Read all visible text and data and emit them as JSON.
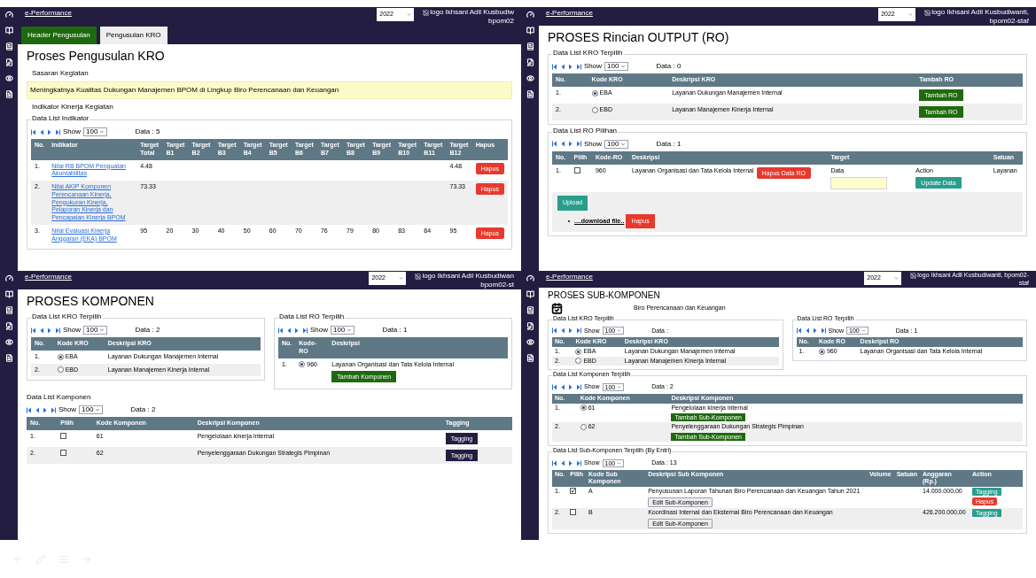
{
  "panels": [
    {
      "header": {
        "link": "e-Performance",
        "year": "2022",
        "user": "logo Ikhsani Adil Kusbudiw",
        "role": "bpom02"
      },
      "tabs": [
        {
          "label": "Header Pengusulan",
          "selected": false
        },
        {
          "label": "Pengusulan KRO",
          "selected": true
        }
      ],
      "title": "Proses Pengusulan KRO",
      "blocks": [
        {
          "kind": "label",
          "text": "Sasaran Kegiatan"
        },
        {
          "kind": "highlight",
          "text": "Meningkatnya Kualitas Dukungan Manajemen BPOM di Lingkup Biro Perencanaan dan Keuangan"
        },
        {
          "kind": "label",
          "text": "Indikator Kinerja Kegiatan"
        },
        {
          "kind": "fieldset",
          "legend": "Data List Indikator",
          "blocks": [
            {
              "kind": "pager",
              "show_label": "Show",
              "show": "100",
              "data": "Data : 5"
            },
            {
              "kind": "table",
              "columns": [
                "No.",
                "Indikator",
                "Target Total",
                "Target B1",
                "Target B2",
                "Target B3",
                "Target B4",
                "Target B5",
                "Target B6",
                "Target B7",
                "Target B8",
                "Target B9",
                "Target B10",
                "Target B11",
                "Target B12",
                "Hapus"
              ],
              "rows": [
                [
                  "1.",
                  [
                    {
                      "kind": "link",
                      "text": "Nilai RB BPOM Penguatan Akuntabilitas"
                    }
                  ],
                  "4.48",
                  null,
                  null,
                  null,
                  null,
                  null,
                  null,
                  null,
                  null,
                  null,
                  null,
                  null,
                  "4.48",
                  [
                    {
                      "kind": "danger",
                      "text": "Hapus"
                    }
                  ]
                ],
                [
                  "2.",
                  [
                    {
                      "kind": "link",
                      "text": "Nilai AKIP Komponen Perencanaan Kinerja, Pengukuran Kinerja, Pelaporan Kinerja dan Pencapaian Kinerja BPOM"
                    }
                  ],
                  "73.33",
                  null,
                  null,
                  null,
                  null,
                  null,
                  null,
                  null,
                  null,
                  null,
                  null,
                  null,
                  "73.33",
                  [
                    {
                      "kind": "danger",
                      "text": "Hapus"
                    }
                  ]
                ],
                [
                  "3.",
                  [
                    {
                      "kind": "link",
                      "text": "Nilai Evaluasi Kinerja Anggaran (EKA) BPOM"
                    }
                  ],
                  "95",
                  "20",
                  "30",
                  "40",
                  "50",
                  "60",
                  "70",
                  "76",
                  "79",
                  "80",
                  "83",
                  "84",
                  "95",
                  [
                    {
                      "kind": "danger",
                      "text": "Hapus"
                    }
                  ]
                ]
              ]
            }
          ]
        }
      ]
    },
    {
      "header": {
        "link": "e-Performance",
        "year": "2022",
        "user": "logo Ikhsani Adil Kusbudiwanti,",
        "role": "bpom02-staf"
      },
      "title": "PROSES Rincian OUTPUT (RO)",
      "blocks": [
        {
          "kind": "fieldset",
          "legend": "Data List KRO Terpilih",
          "blocks": [
            {
              "kind": "pager",
              "show_label": "Show",
              "show": "100",
              "data": "Data : 0"
            },
            {
              "kind": "table",
              "columns": [
                "No.",
                "Kode KRO",
                "Deskripsi KRO",
                "Tambah RO"
              ],
              "rows": [
                [
                  "1.",
                  [
                    {
                      "kind": "radio",
                      "selected": true,
                      "text": "EBA"
                    }
                  ],
                  "Layanan Dukungan Manajemen Internal",
                  [
                    {
                      "kind": "add",
                      "text": "Tambah RO"
                    }
                  ]
                ],
                [
                  "2.",
                  [
                    {
                      "kind": "radio",
                      "selected": false,
                      "text": "EBD"
                    }
                  ],
                  "Layanan Manajemen Kinerja Internal",
                  [
                    {
                      "kind": "add",
                      "text": "Tambah RO"
                    }
                  ]
                ]
              ]
            }
          ]
        },
        {
          "kind": "fieldset",
          "legend": "Data List RO Pilihan",
          "blocks": [
            {
              "kind": "pager",
              "show_label": "Show",
              "show": "100",
              "data": "Data : 1"
            },
            {
              "kind": "table",
              "columns": [
                "No.",
                "Pilih",
                "Kode-RO",
                "Deskripsi",
                "Target",
                null,
                "Satuan"
              ],
              "rows": [
                [
                  "1.",
                  [
                    {
                      "kind": "check",
                      "checked": false
                    }
                  ],
                  "960",
                  [
                    {
                      "kind": "text",
                      "text": "Layanan Organisasi dan Tata Kelola Internal"
                    },
                    {
                      "kind": "danger",
                      "text": "Hapus Data RO"
                    }
                  ],
                  [
                    {
                      "kind": "caption",
                      "text": "Data"
                    },
                    {
                      "kind": "input"
                    }
                  ],
                  [
                    {
                      "kind": "caption",
                      "text": "Action"
                    },
                    {
                      "kind": "teal",
                      "text": "Update Data"
                    }
                  ],
                  "Layanan"
                ]
              ]
            },
            {
              "kind": "files",
              "upload": "Upload",
              "link": "....download file..",
              "delete": "Hapus"
            }
          ]
        }
      ]
    },
    {
      "header": {
        "link": "e-Performance",
        "year": "2022",
        "user": "logo Ikhsani Adil Kusbudiwan",
        "role": "bpom02-st"
      },
      "title": "PROSES KOMPONEN",
      "blocks": [
        {
          "kind": "row",
          "blocks": [
            {
              "kind": "fieldset",
              "legend": "Data List KRO Terpilih",
              "blocks": [
                {
                  "kind": "pager",
                  "show_label": "Show",
                  "show": "100",
                  "data": "Data : 2"
                },
                {
                  "kind": "table",
                  "columns": [
                    "No.",
                    "Kode KRO",
                    "Deskripsi KRO"
                  ],
                  "rows": [
                    [
                      "1.",
                      [
                        {
                          "kind": "radio",
                          "selected": true,
                          "text": "EBA"
                        }
                      ],
                      "Layanan Dukungan Manajemen Internal"
                    ],
                    [
                      "2.",
                      [
                        {
                          "kind": "radio",
                          "selected": false,
                          "text": "EBD"
                        }
                      ],
                      "Layanan Manajemen Kinerja Internal"
                    ]
                  ]
                }
              ]
            },
            {
              "kind": "fieldset",
              "legend": "Data List RO Terpilih",
              "blocks": [
                {
                  "kind": "pager",
                  "show_label": "Show",
                  "show": "100",
                  "data": "Data : 1"
                },
                {
                  "kind": "table",
                  "columns": [
                    "No.",
                    "Kode-RO",
                    "Deskripsi"
                  ],
                  "rows": [
                    [
                      "1.",
                      [
                        {
                          "kind": "radio",
                          "selected": true,
                          "text": "960"
                        }
                      ],
                      [
                        {
                          "kind": "caption",
                          "text": "Layanan Organisasi dan Tata Kelola Internal"
                        },
                        {
                          "kind": "add",
                          "text": "Tambah Komponen"
                        }
                      ]
                    ]
                  ]
                }
              ]
            }
          ]
        },
        {
          "kind": "section",
          "legend": "Data List Komponen",
          "blocks": [
            {
              "kind": "pager",
              "show_label": "Show",
              "show": "100",
              "data": "Data : 2"
            },
            {
              "kind": "table",
              "columns": [
                "No.",
                "Pilih",
                "Kode Komponen",
                "Deskripsi Komponen",
                "Tagging"
              ],
              "rows": [
                [
                  "1.",
                  [
                    {
                      "kind": "check",
                      "checked": false
                    }
                  ],
                  "61",
                  "Pengelolaan kinerja internal",
                  [
                    {
                      "kind": "tag",
                      "text": "Tagging"
                    }
                  ]
                ],
                [
                  "2.",
                  [
                    {
                      "kind": "check",
                      "checked": false
                    }
                  ],
                  "62",
                  "Penyelenggaraan Dukungan Strategis Pimpinan",
                  [
                    {
                      "kind": "tag",
                      "text": "Tagging"
                    }
                  ]
                ]
              ]
            }
          ]
        }
      ]
    },
    {
      "header": {
        "link": "e-Performance",
        "year": "2022",
        "user": "logo Ikhsani Adil Kusbudiwanti, bpom02-",
        "role": "staf"
      },
      "title": "PROSES SUB-KOMPONEN",
      "blocks": [
        {
          "kind": "org",
          "text": "Biro Perencanaan dan Keuangan"
        },
        {
          "kind": "row",
          "blocks": [
            {
              "kind": "fieldset",
              "legend": "Data List KRO Terpilih",
              "blocks": [
                {
                  "kind": "pager",
                  "show_label": "Show",
                  "show": "100",
                  "data": "Data :"
                },
                {
                  "kind": "table",
                  "columns": [
                    "No.",
                    "Kode KRO",
                    "Deskripsi KRO"
                  ],
                  "rows": [
                    [
                      "1.",
                      [
                        {
                          "kind": "radio",
                          "selected": true,
                          "text": "EBA"
                        }
                      ],
                      "Layanan Dukungan Manajemen Internal"
                    ],
                    [
                      "2.",
                      [
                        {
                          "kind": "radio",
                          "selected": false,
                          "text": "EBD"
                        }
                      ],
                      "Layanan Manajemen Kinerja Internal"
                    ]
                  ]
                }
              ]
            },
            {
              "kind": "fieldset",
              "legend": "Data List RO Terpilih",
              "blocks": [
                {
                  "kind": "pager",
                  "show_label": "Show",
                  "show": "100",
                  "data": "Data : 1"
                },
                {
                  "kind": "table",
                  "columns": [
                    "No.",
                    "Kode RO",
                    "Deskripsi RO"
                  ],
                  "rows": [
                    [
                      "1.",
                      [
                        {
                          "kind": "radio",
                          "selected": true,
                          "text": "960"
                        }
                      ],
                      "Layanan Organisasi dan Tata Kelola Internal"
                    ]
                  ]
                }
              ]
            }
          ]
        },
        {
          "kind": "fieldset",
          "legend": "Data List Komponen Terpilih",
          "blocks": [
            {
              "kind": "pager",
              "show_label": "Show",
              "show": "100",
              "data": "Data : 2"
            },
            {
              "kind": "table",
              "columns": [
                "No.",
                "Kode Komponen",
                "Deskripsi Komponen"
              ],
              "rows": [
                [
                  "1.",
                  [
                    {
                      "kind": "radio",
                      "selected": true,
                      "text": "61"
                    }
                  ],
                  [
                    {
                      "kind": "caption",
                      "text": "Pengelolaan kinerja internal"
                    },
                    {
                      "kind": "add",
                      "text": "Tambah Sub-Komponen"
                    }
                  ]
                ],
                [
                  "2.",
                  [
                    {
                      "kind": "radio",
                      "selected": false,
                      "text": "62"
                    }
                  ],
                  [
                    {
                      "kind": "caption",
                      "text": "Penyelenggaraan Dukungan Strategis Pimpinan"
                    },
                    {
                      "kind": "add",
                      "text": "Tambah Sub-Komponen"
                    }
                  ]
                ]
              ]
            }
          ]
        },
        {
          "kind": "fieldset",
          "legend": "Data List Sub-Komponen Terpilih (By Entri)",
          "blocks": [
            {
              "kind": "pager",
              "show_label": "Show",
              "show": "100",
              "data": "Data : 13"
            },
            {
              "kind": "table",
              "columns": [
                "No.",
                "Pilih",
                "Kode Sub Komponen",
                "Deskripsi Sub Komponen",
                "Volume",
                "Satuan",
                "Anggaran (Rp.)",
                "Action"
              ],
              "rows": [
                [
                  "1.",
                  [
                    {
                      "kind": "check",
                      "checked": true
                    }
                  ],
                  "A",
                  [
                    {
                      "kind": "text",
                      "text": "Penyusunan Laporan Tahunan Biro Perencanaan dan Keuangan Tahun 2021"
                    },
                    {
                      "kind": "plain",
                      "text": "Edit Sub-Komponen"
                    }
                  ],
                  null,
                  null,
                  "14.000.000,00",
                  [
                    {
                      "kind": "teal",
                      "text": "Tagging"
                    },
                    {
                      "kind": "danger",
                      "text": "Hapus"
                    }
                  ]
                ],
                [
                  "2.",
                  [
                    {
                      "kind": "check",
                      "checked": false
                    }
                  ],
                  "B",
                  [
                    {
                      "kind": "text",
                      "text": "Koordinasi Internal dan Eksternal Biro Perencanaan dan Keuangan"
                    },
                    {
                      "kind": "plain",
                      "text": "Edit Sub-Komponen"
                    }
                  ],
                  null,
                  null,
                  "426.200.000,00",
                  [
                    {
                      "kind": "teal",
                      "text": "Tagging"
                    }
                  ]
                ]
              ]
            }
          ]
        }
      ]
    }
  ]
}
